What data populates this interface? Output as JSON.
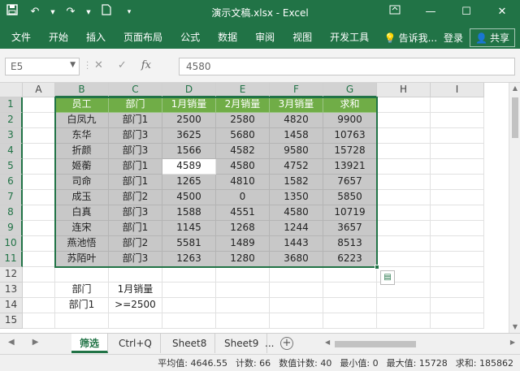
{
  "window": {
    "title": "演示文稿.xlsx - Excel",
    "qat_icons": [
      "save-icon",
      "undo-icon",
      "redo-icon",
      "new-file-icon",
      "customize-qat-icon"
    ],
    "controls": [
      "ribbon-display-icon",
      "minimize-icon",
      "restore-icon",
      "close-icon"
    ]
  },
  "ribbon": {
    "tabs": [
      "文件",
      "开始",
      "插入",
      "页面布局",
      "公式",
      "数据",
      "审阅",
      "视图",
      "开发工具"
    ],
    "tell_me": "告诉我...",
    "login": "登录",
    "share": "共享"
  },
  "formula_bar": {
    "name_box": "E5",
    "formula": "4580",
    "fx_label": "fx"
  },
  "columns": [
    "A",
    "B",
    "C",
    "D",
    "E",
    "F",
    "G",
    "H",
    "I"
  ],
  "rows": [
    "1",
    "2",
    "3",
    "4",
    "5",
    "6",
    "7",
    "8",
    "9",
    "10",
    "11",
    "12",
    "13",
    "14",
    "15"
  ],
  "table": {
    "headers": [
      "员工",
      "部门",
      "1月销量",
      "2月销量",
      "3月销量",
      "求和"
    ],
    "rows": [
      [
        "白凤九",
        "部门1",
        "2500",
        "2580",
        "4820",
        "9900"
      ],
      [
        "东华",
        "部门3",
        "3625",
        "5680",
        "1458",
        "10763"
      ],
      [
        "折颜",
        "部门3",
        "1566",
        "4582",
        "9580",
        "15728"
      ],
      [
        "姬蘅",
        "部门1",
        "4589",
        "4580",
        "4752",
        "13921"
      ],
      [
        "司命",
        "部门1",
        "1265",
        "4810",
        "1582",
        "7657"
      ],
      [
        "成玉",
        "部门2",
        "4500",
        "0",
        "1350",
        "5850"
      ],
      [
        "白真",
        "部门3",
        "1588",
        "4551",
        "4580",
        "10719"
      ],
      [
        "连宋",
        "部门1",
        "1145",
        "1268",
        "1244",
        "3657"
      ],
      [
        "燕池悟",
        "部门2",
        "5581",
        "1489",
        "1443",
        "8513"
      ],
      [
        "苏陌叶",
        "部门3",
        "1263",
        "1280",
        "3680",
        "6223"
      ]
    ]
  },
  "criteria": {
    "row13": [
      "部门",
      "1月销量"
    ],
    "row14": [
      "部门1",
      ">=2500"
    ]
  },
  "sheets": {
    "tabs": [
      "筛选",
      "Ctrl+Q",
      "Sheet8",
      "Sheet9"
    ],
    "more": "...",
    "add": "+"
  },
  "status": {
    "average": "平均值: 4646.55",
    "count": "计数: 66",
    "numcount": "数值计数: 40",
    "min": "最小值: 0",
    "max": "最大值: 15728",
    "sum": "求和: 185862"
  },
  "colors": {
    "excel_green": "#217346",
    "header_fill": "#70ad47",
    "selection_gray": "#c8c8c8"
  }
}
